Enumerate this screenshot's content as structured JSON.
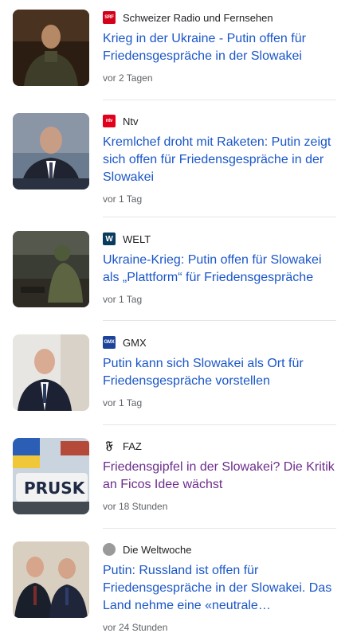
{
  "articles": [
    {
      "source": "Schweizer Radio und Fernsehen",
      "logo": {
        "text": "SRF",
        "bg": "#d4001a",
        "color": "#ffffff"
      },
      "headline": "Krieg in der Ukraine - Putin offen für Friedensgespräche in der Slowakei",
      "time": "vor 2 Tagen",
      "visited": false
    },
    {
      "source": "Ntv",
      "logo": {
        "text": "ntv",
        "bg": "#e2001a",
        "color": "#ffffff"
      },
      "headline": "Kremlchef droht mit Raketen: Putin zeigt sich offen für Friedensgespräche in der Slowakei",
      "time": "vor 1 Tag",
      "visited": false
    },
    {
      "source": "WELT",
      "logo": {
        "text": "W",
        "bg": "#0a3a5c",
        "color": "#ffffff"
      },
      "headline": "Ukraine-Krieg: Putin offen für Slowakei als „Plattform“ für Friedensgespräche",
      "time": "vor 1 Tag",
      "visited": false
    },
    {
      "source": "GMX",
      "logo": {
        "text": "GMX",
        "bg": "#1c449b",
        "color": "#ffffff"
      },
      "headline": "Putin kann sich Slowakei als Ort für Friedensgespräche vorstellen",
      "time": "vor 1 Tag",
      "visited": false
    },
    {
      "source": "FAZ",
      "logo": {
        "text": "𝔉",
        "bg": "#ffffff",
        "color": "#202124"
      },
      "headline": "Friedensgipfel in der Slowakei? Die Kritik an Ficos Idee wächst",
      "time": "vor 18 Stunden",
      "visited": true
    },
    {
      "source": "Die Weltwoche",
      "logo": {
        "text": "",
        "bg": "#9a9a9a",
        "color": "#ffffff"
      },
      "headline": "Putin: Russland ist offen für Friedensgespräche in der Slowakei. Das Land nehme eine «neutrale…",
      "time": "vor 24 Stunden",
      "visited": false
    }
  ],
  "colors": {
    "headline_link": "#1a56c9",
    "headline_visited": "#6c2c8c",
    "meta_text": "#5f6368",
    "divider": "#e6e6e6"
  }
}
